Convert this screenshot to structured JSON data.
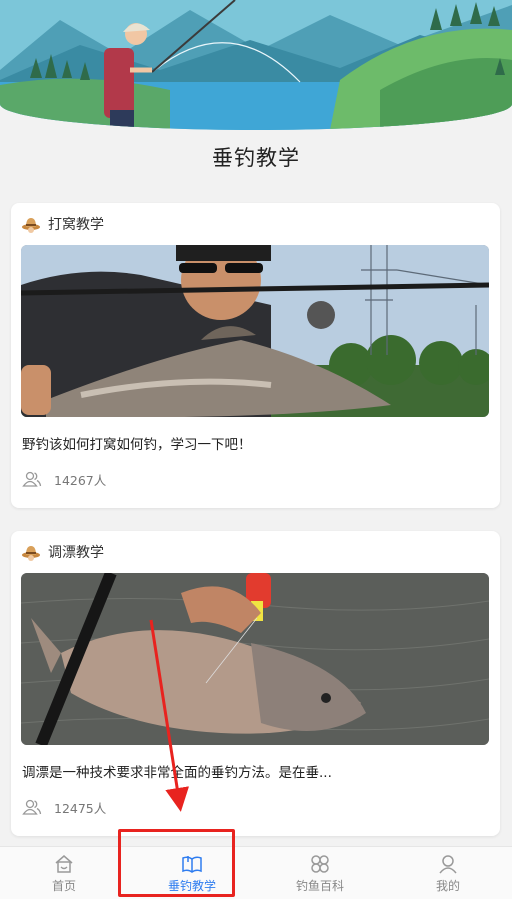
{
  "header": {
    "title": "垂钓教学"
  },
  "cards": [
    {
      "category": "打窝教学",
      "description": "野钓该如何打窝如何钓，学习一下吧！",
      "views": "14267人"
    },
    {
      "category": "调漂教学",
      "description": "调漂是一种技术要求非常全面的垂钓方法。是在垂...",
      "views": "12475人"
    }
  ],
  "tabbar": {
    "items": [
      {
        "label": "首页",
        "icon": "home-icon",
        "active": false
      },
      {
        "label": "垂钓教学",
        "icon": "book-icon",
        "active": true
      },
      {
        "label": "钓鱼百科",
        "icon": "grid-icon",
        "active": false
      },
      {
        "label": "我的",
        "icon": "user-icon",
        "active": false
      }
    ]
  },
  "colors": {
    "accent": "#2f7df0",
    "annotation": "#e8231f",
    "background": "#f2f2f2"
  }
}
